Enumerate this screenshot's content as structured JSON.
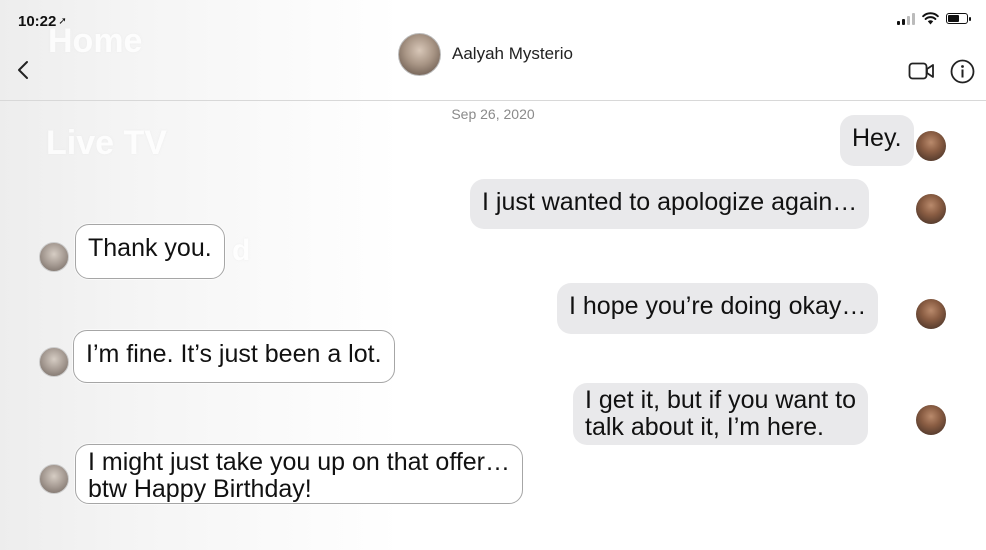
{
  "status_bar": {
    "time": "10:22",
    "location_glyph": "➚"
  },
  "background_ghost": {
    "home": "Home",
    "live": "Live TV",
    "d": "d"
  },
  "header": {
    "contact_name": "Aalyah Mysterio",
    "back_icon": "chevron-left-icon",
    "video_icon": "video-camera-icon",
    "info_icon": "info-icon"
  },
  "conversation": {
    "date": "Sep 26, 2020",
    "messages": [
      {
        "from": "me",
        "text": "Hey."
      },
      {
        "from": "me",
        "text": "I just wanted to apologize again…"
      },
      {
        "from": "her",
        "text": "Thank you."
      },
      {
        "from": "me",
        "text": "I hope you’re doing okay…"
      },
      {
        "from": "her",
        "text": "I’m fine. It’s just been a lot."
      },
      {
        "from": "me",
        "lines": [
          "I get it, but if you want to",
          "talk about it, I’m here."
        ]
      },
      {
        "from": "her",
        "lines": [
          "I might just take you up on that offer…",
          "btw Happy Birthday!"
        ]
      }
    ]
  },
  "colors": {
    "outgoing_bubble": "#e9e9eb",
    "incoming_bubble": "#ffffff",
    "incoming_border": "#a6a6a6",
    "date_text": "#8a8a8a"
  }
}
